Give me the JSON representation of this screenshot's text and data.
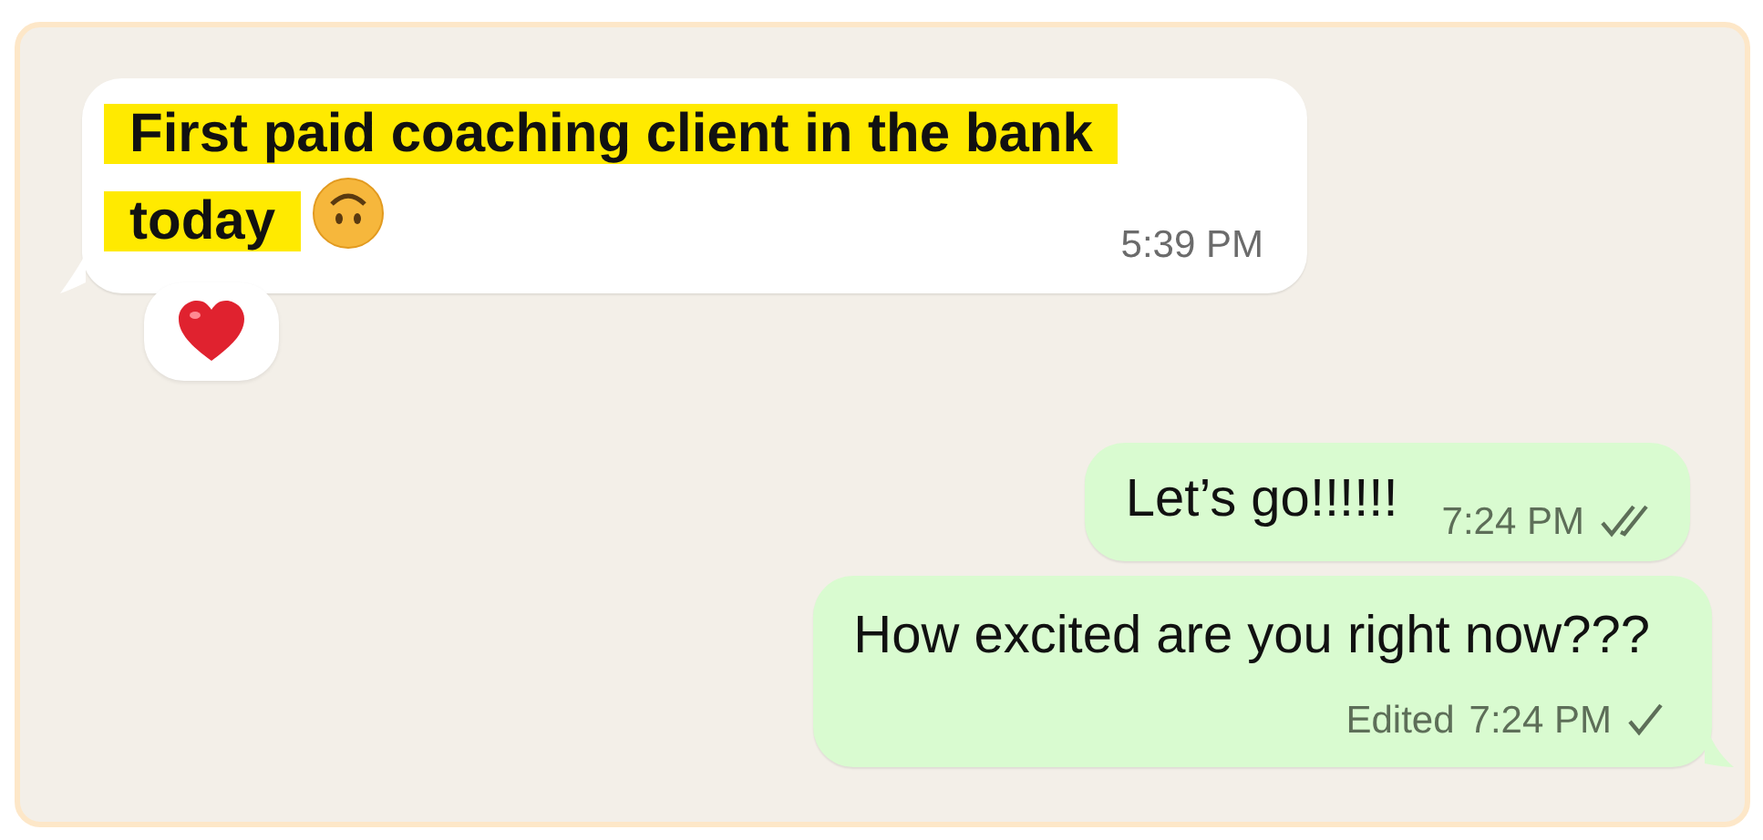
{
  "messages": [
    {
      "outgoing": false,
      "text": "First paid coaching client in the bank today",
      "highlighted": true,
      "has_emoji": true,
      "time": "5:39 PM",
      "reacted": true
    },
    {
      "outgoing": true,
      "text": "Let’s go!!!!!!",
      "time": "7:24 PM",
      "read": true
    },
    {
      "outgoing": true,
      "text": "How excited are you right now???",
      "edited_label": "Edited",
      "time": "7:24 PM",
      "read": false
    }
  ]
}
